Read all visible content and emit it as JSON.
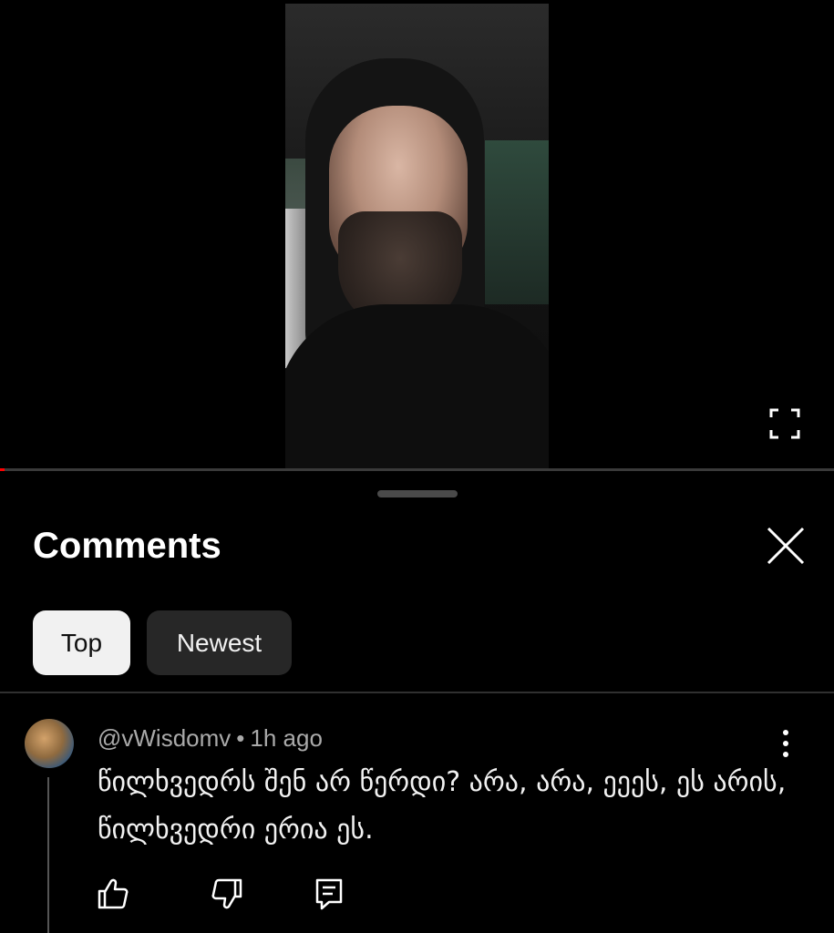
{
  "player": {
    "progress_fraction": 0.006,
    "progress_color": "#ff0000",
    "icons": {
      "fullscreen": "fullscreen-icon"
    }
  },
  "comments_panel": {
    "title": "Comments",
    "close_icon": "close-icon",
    "filters": [
      {
        "label": "Top",
        "selected": true
      },
      {
        "label": "Newest",
        "selected": false
      }
    ]
  },
  "comments": [
    {
      "author": "@vWisdomv",
      "separator": "•",
      "time": "1h ago",
      "text": "წილხვედრს შენ არ წერდი? არა, არა, ეეეს, ეს არის, წილხვედრი ერია ეს.",
      "actions": {
        "like_icon": "thumbs-up-icon",
        "dislike_icon": "thumbs-down-icon",
        "reply_icon": "reply-icon",
        "more_icon": "more-vert-icon"
      }
    }
  ]
}
